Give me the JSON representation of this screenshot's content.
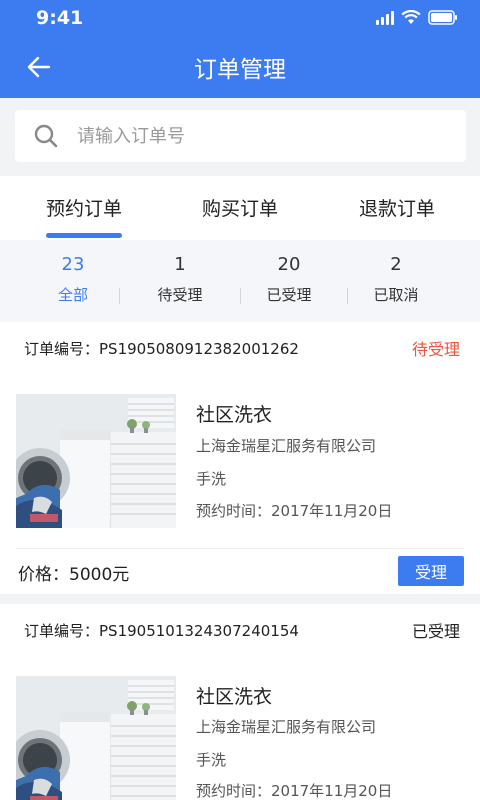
{
  "status_bar": {
    "time": "9:41"
  },
  "header": {
    "title": "订单管理",
    "back_icon": "arrow-left-icon"
  },
  "search": {
    "placeholder": "请输入订单号",
    "value": ""
  },
  "tabs": [
    {
      "label": "预约订单",
      "active": true
    },
    {
      "label": "购买订单",
      "active": false
    },
    {
      "label": "退款订单",
      "active": false
    }
  ],
  "stats": [
    {
      "count": "23",
      "label": "全部",
      "active": true
    },
    {
      "count": "1",
      "label": "待受理",
      "active": false
    },
    {
      "count": "20",
      "label": "已受理",
      "active": false
    },
    {
      "count": "2",
      "label": "已取消",
      "active": false
    }
  ],
  "orders": [
    {
      "no_label": "订单编号：",
      "no": "PS1905080912382001262",
      "status": "待受理",
      "title": "社区洗衣",
      "company": "上海金瑞星汇服务有限公司",
      "type": "手洗",
      "time": "预约时间：2017年11月20日",
      "price": "价格：5000元",
      "action": "受理"
    },
    {
      "no_label": "订单编号：",
      "no": "PS1905101324307240154",
      "status": "已受理",
      "title": "社区洗衣",
      "company": "上海金瑞星汇服务有限公司",
      "type": "手洗",
      "time": "预约时间：2017年11月20日"
    }
  ],
  "colors": {
    "primary": "#3d7cf0",
    "pending": "#f0533e"
  }
}
